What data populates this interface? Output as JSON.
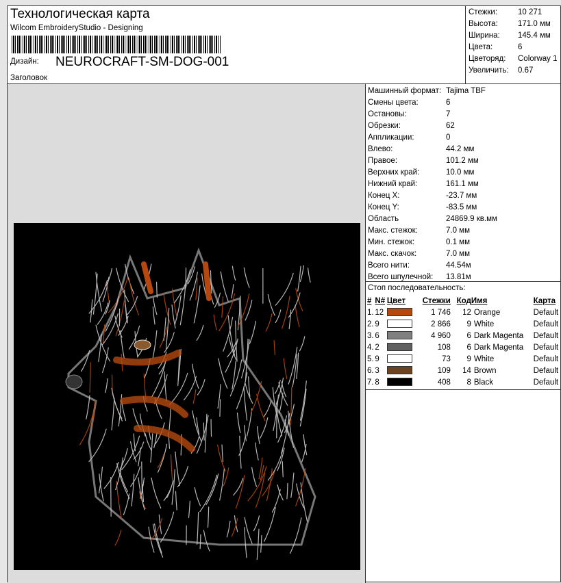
{
  "header": {
    "title": "Технологическая карта",
    "subtitle": "Wilcom EmbroideryStudio - Designing",
    "design_label": "Дизайн:",
    "design_name": "NEUROCRAFT-SM-DOG-001",
    "heading_label": "Заголовок"
  },
  "info": [
    {
      "k": "Стежки:",
      "v": "10 271"
    },
    {
      "k": "Высота:",
      "v": "171.0 мм"
    },
    {
      "k": "Ширина:",
      "v": "145.4 мм"
    },
    {
      "k": "Цвета:",
      "v": "6"
    },
    {
      "k": "Цветоряд:",
      "v": "Colorway 1"
    },
    {
      "k": "Увеличить:",
      "v": "0.67"
    }
  ],
  "stats": [
    {
      "k": "Машинный формат:",
      "v": "Tajima TBF"
    },
    {
      "k": "Смены цвета:",
      "v": "6"
    },
    {
      "k": "Остановы:",
      "v": "7"
    },
    {
      "k": "Обрезки:",
      "v": "62"
    },
    {
      "k": "Аппликации:",
      "v": "0"
    },
    {
      "k": "Влево:",
      "v": "44.2 мм"
    },
    {
      "k": "Правое:",
      "v": "101.2 мм"
    },
    {
      "k": "Верхних край:",
      "v": "10.0 мм"
    },
    {
      "k": "Нижний край:",
      "v": "161.1 мм"
    },
    {
      "k": "Конец X:",
      "v": "-23.7 мм"
    },
    {
      "k": "Конец Y:",
      "v": "-83.5 мм"
    },
    {
      "k": "Область",
      "v": "24869.9 кв.мм"
    },
    {
      "k": "Макс. стежок:",
      "v": "7.0 мм"
    },
    {
      "k": "Мин. стежок:",
      "v": "0.1 мм"
    },
    {
      "k": "Макс. скачок:",
      "v": "7.0 мм"
    },
    {
      "k": "Всего нити:",
      "v": "44.54м"
    },
    {
      "k": "Всего шпулечной:",
      "v": "13.81м"
    }
  ],
  "sequence": {
    "title": "Стоп последовательность:",
    "columns": [
      "#",
      "N#",
      "Цвет",
      "Стежки",
      "Код",
      "Имя",
      "Карта"
    ],
    "rows": [
      {
        "i": "1.",
        "n": "12",
        "color": "#b5480e",
        "stitches": "1 746",
        "code": "12",
        "name": "Orange",
        "map": "Default"
      },
      {
        "i": "2.",
        "n": "9",
        "color": "#ffffff",
        "stitches": "2 866",
        "code": "9",
        "name": "White",
        "map": "Default"
      },
      {
        "i": "3.",
        "n": "6",
        "color": "#808080",
        "stitches": "4 960",
        "code": "6",
        "name": "Dark Magenta",
        "map": "Default"
      },
      {
        "i": "4.",
        "n": "2",
        "color": "#606060",
        "stitches": "108",
        "code": "6",
        "name": "Dark Magenta",
        "map": "Default"
      },
      {
        "i": "5.",
        "n": "9",
        "color": "#ffffff",
        "stitches": "73",
        "code": "9",
        "name": "White",
        "map": "Default"
      },
      {
        "i": "6.",
        "n": "3",
        "color": "#6b4424",
        "stitches": "109",
        "code": "14",
        "name": "Brown",
        "map": "Default"
      },
      {
        "i": "7.",
        "n": "8",
        "color": "#000000",
        "stitches": "408",
        "code": "8",
        "name": "Black",
        "map": "Default"
      }
    ]
  }
}
